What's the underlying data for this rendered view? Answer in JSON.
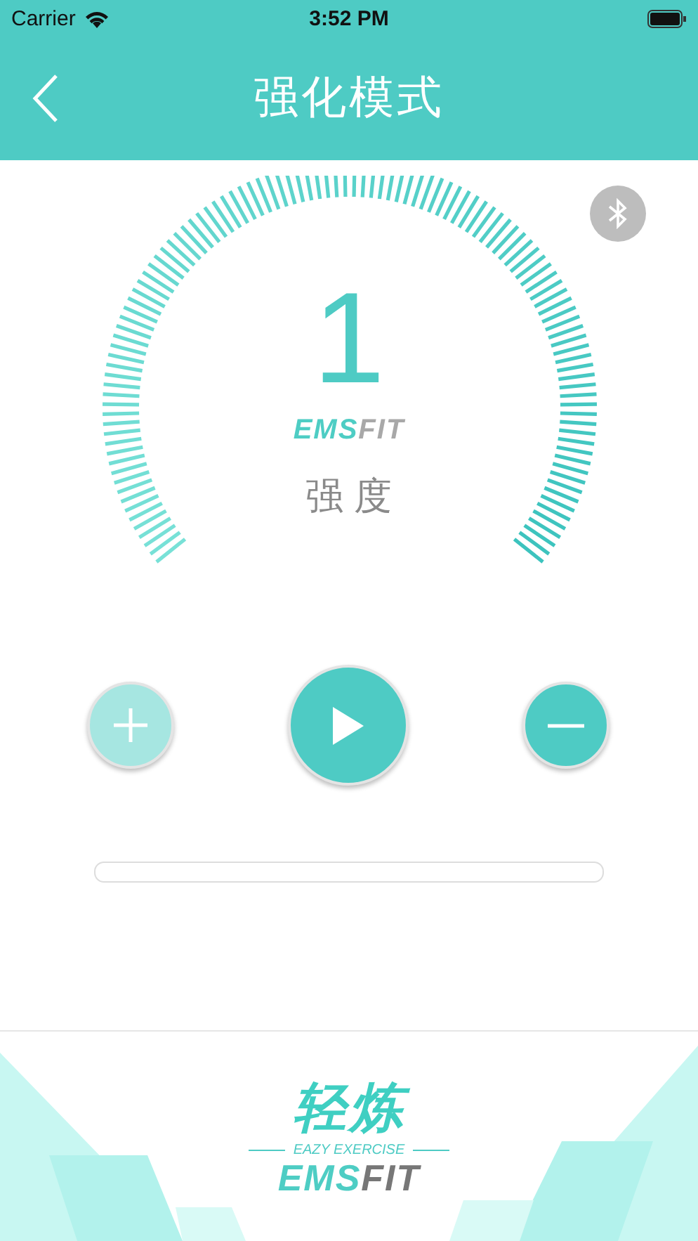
{
  "status_bar": {
    "carrier": "Carrier",
    "time": "3:52 PM"
  },
  "header": {
    "title": "强化模式"
  },
  "bluetooth": {
    "connected": false
  },
  "gauge": {
    "value": "1",
    "brand": [
      {
        "text": "EMS",
        "color": "#4ecdc4"
      },
      {
        "text": "FIT",
        "color": "#a8a8a8"
      }
    ],
    "label": "强 度"
  },
  "controls": [
    {
      "kind": "plus",
      "disabled": true
    },
    {
      "kind": "play",
      "disabled": false
    },
    {
      "kind": "minus",
      "disabled": false
    }
  ],
  "progress": {
    "level": 0
  },
  "footer": {
    "logo_cn": "轻炼",
    "tagline": "EAZY EXERCISE",
    "brand": [
      {
        "text": "EMS",
        "color": "#4ecdc4"
      },
      {
        "text": "FIT",
        "color": "#777777"
      }
    ]
  }
}
